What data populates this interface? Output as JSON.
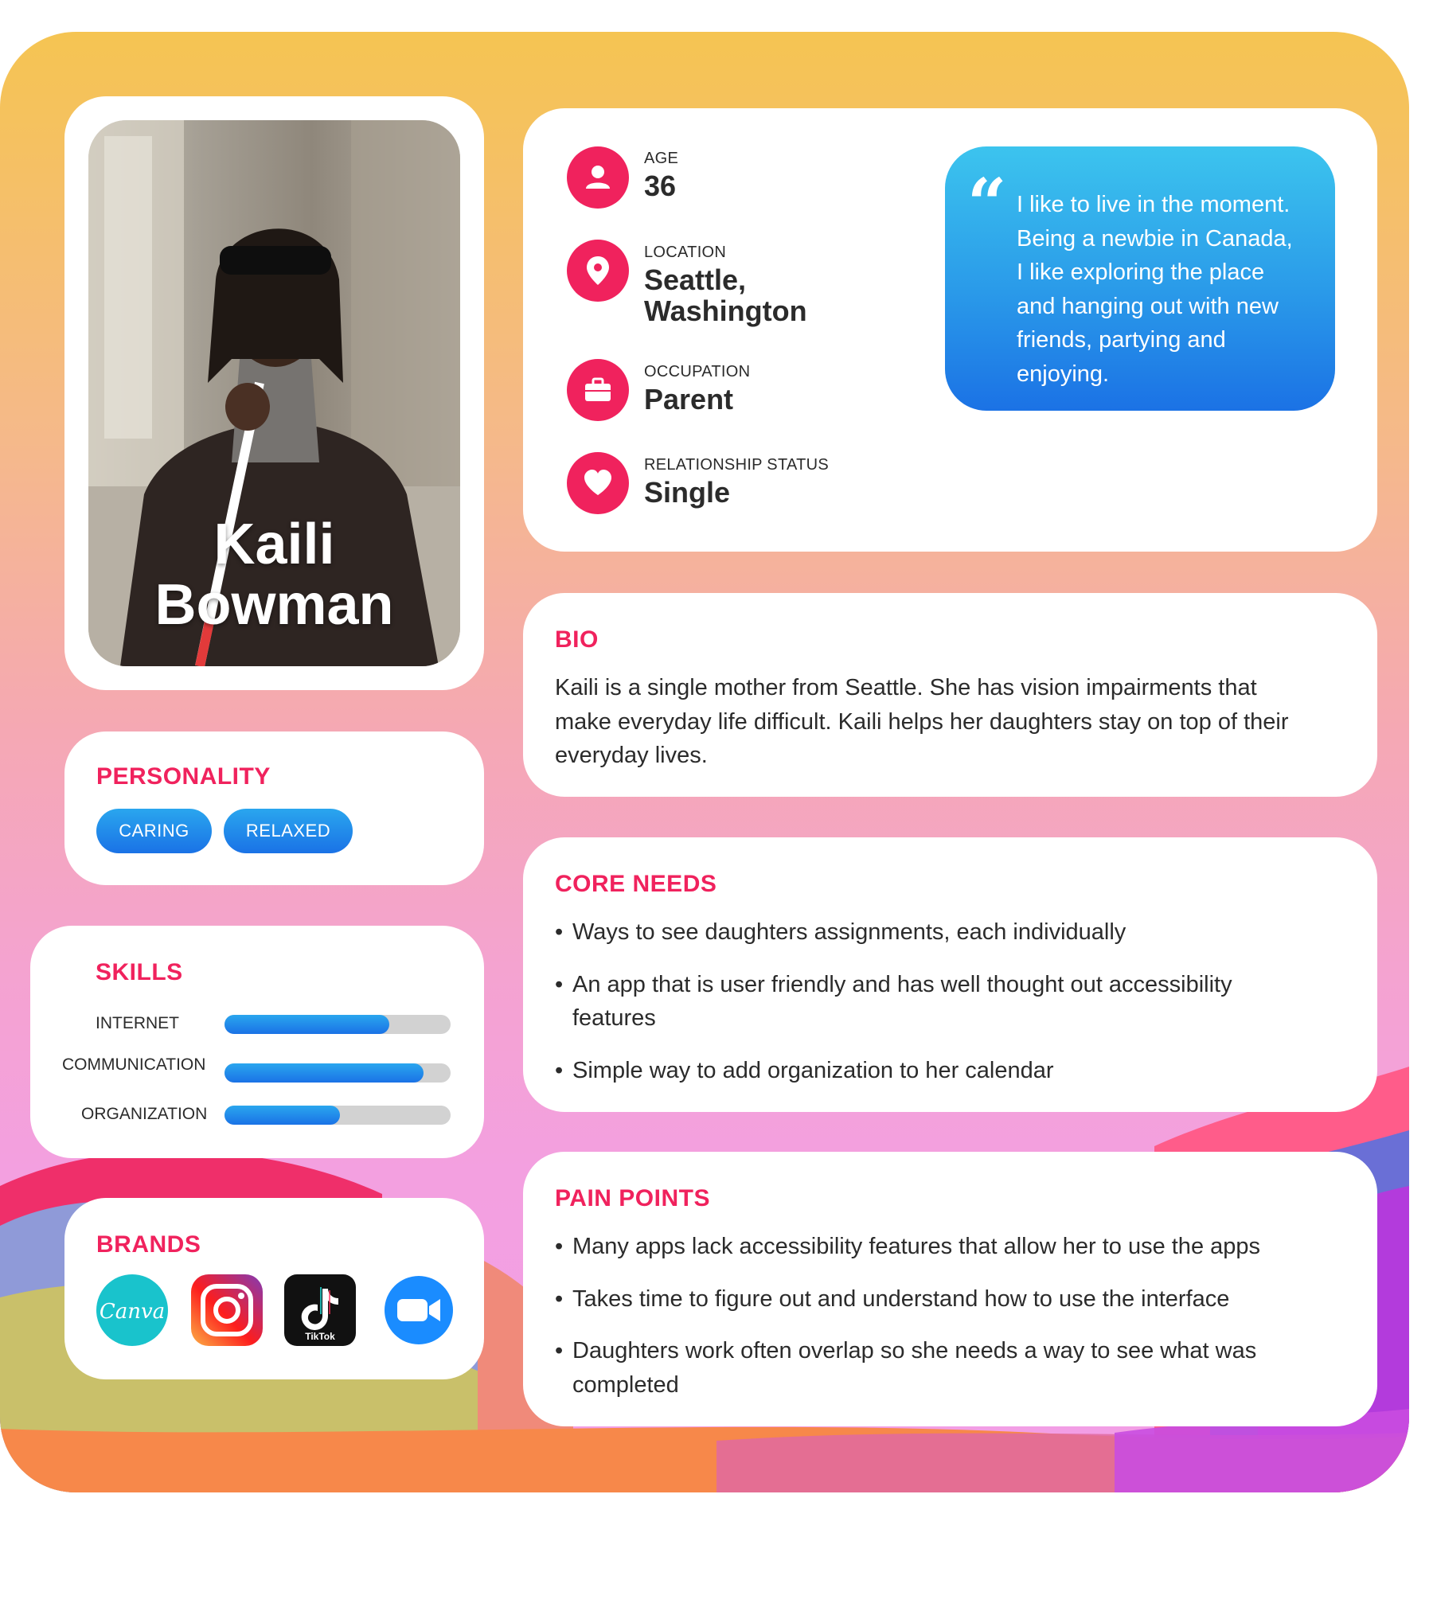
{
  "persona": {
    "name_line1": "Kaili",
    "name_line2": "Bowman",
    "photo_icon": "person-with-white-cane-photo"
  },
  "info": {
    "age": {
      "label": "AGE",
      "value": "36",
      "icon": "user-icon"
    },
    "location": {
      "label": "LOCATION",
      "value_line1": "Seattle,",
      "value_line2": "Washington",
      "icon": "map-pin-icon"
    },
    "occupation": {
      "label": "OCCUPATION",
      "value": "Parent",
      "icon": "briefcase-icon"
    },
    "relationship": {
      "label": "RELATIONSHIP STATUS",
      "value": "Single",
      "icon": "heart-icon"
    }
  },
  "quote": {
    "lines": [
      "I like to live in the moment.",
      "Being a newbie in Canada,",
      "I like exploring the place",
      "and hanging out with new",
      "friends, partying and",
      "enjoying."
    ]
  },
  "personality": {
    "heading": "PERSONALITY",
    "tags": [
      "CARING",
      "RELAXED"
    ]
  },
  "skills": {
    "heading": "SKILLS",
    "items": [
      {
        "label": "INTERNET",
        "level": 0.73
      },
      {
        "label": "COMMUNICATION",
        "level": 0.88
      },
      {
        "label": "ORGANIZATION",
        "level": 0.51
      }
    ]
  },
  "brands": {
    "heading": "BRANDS",
    "items": [
      {
        "name": "Canva",
        "icon": "canva-logo-icon"
      },
      {
        "name": "Instagram",
        "icon": "instagram-logo-icon"
      },
      {
        "name": "TikTok",
        "icon": "tiktok-logo-icon"
      },
      {
        "name": "Zoom",
        "icon": "zoom-logo-icon"
      }
    ]
  },
  "bio": {
    "heading": "BIO",
    "lines": [
      "Kaili is a single mother from Seattle. She has vision impairments that",
      "make everyday life difficult. Kaili helps her daughters stay on top of their",
      "everyday lives."
    ]
  },
  "core_needs": {
    "heading": "CORE NEEDS",
    "items": [
      "Ways to see daughters assignments, each individually",
      "An app that is user friendly and has well thought out accessibility features",
      "Simple way to add organization to her calendar"
    ]
  },
  "pain_points": {
    "heading": "PAIN POINTS",
    "items": [
      "Many apps lack accessibility features that allow her to use the apps",
      "Takes time to figure out and understand how to use the interface",
      "Daughters work often overlap so she needs a way to see what was completed"
    ]
  },
  "colors": {
    "accent": "#f0225d",
    "blue_start": "#2aa6ee",
    "blue_end": "#1a72e6",
    "background_top": "#f5c452",
    "background_bottom": "#f29ee6"
  }
}
